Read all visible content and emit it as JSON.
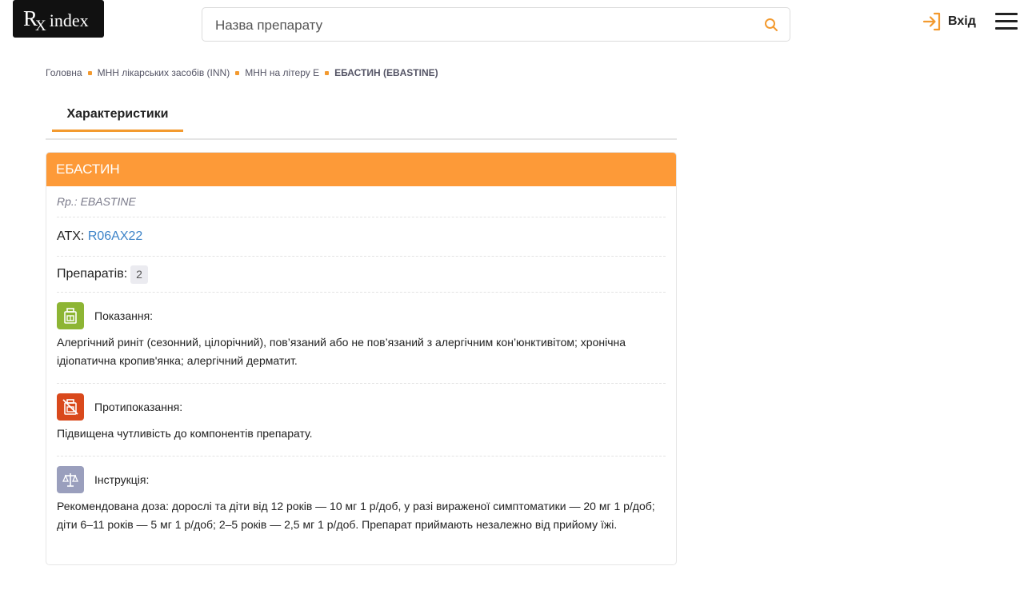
{
  "header": {
    "logo_rx": "R",
    "logo_x": "X",
    "logo_word": "index",
    "search_placeholder": "Назва препарату",
    "login_label": "Вхід"
  },
  "breadcrumb": {
    "items": [
      "Головна",
      "МНН лікарських засобів (INN)",
      "МНН на літеру Е"
    ],
    "current": "ЕБАСТИН (EBASTINE)"
  },
  "tabs": {
    "active": "Характеристики"
  },
  "card": {
    "title": "ЕБАСТИН",
    "latin": "Rp.: EBASTINE",
    "atc_label": "ATX: ",
    "atc_code": "R06AX22",
    "count_label": "Препаратів:",
    "count_value": "2",
    "sections": [
      {
        "title": "Показання:",
        "icon": "indications-icon",
        "color": "#8db534",
        "text": "Алергічний риніт (сезонний, цілорічний), пов’язаний або не пов’язаний з алергічним кон’юнктивітом; хронічна ідіопатична кропив'янка; алергічний дерматит."
      },
      {
        "title": "Протипоказання:",
        "icon": "contraindications-icon",
        "color": "#d9491c",
        "text": "Підвищена чутливість до компонентів препарату."
      },
      {
        "title": "Інструкція:",
        "icon": "scales-icon",
        "color": "#9a9fbd",
        "text": "Рекомендована доза: дорослі та діти від 12 років — 10 мг 1 р/доб, у разі вираженої симптоматики — 20 мг 1 р/доб; діти 6–11 років — 5 мг 1 р/доб; 2–5 років — 2,5 мг 1 р/доб. Препарат приймають незалежно від прийому їжі."
      }
    ]
  },
  "colors": {
    "accent": "#fd9a38",
    "link": "#3d83c8"
  }
}
